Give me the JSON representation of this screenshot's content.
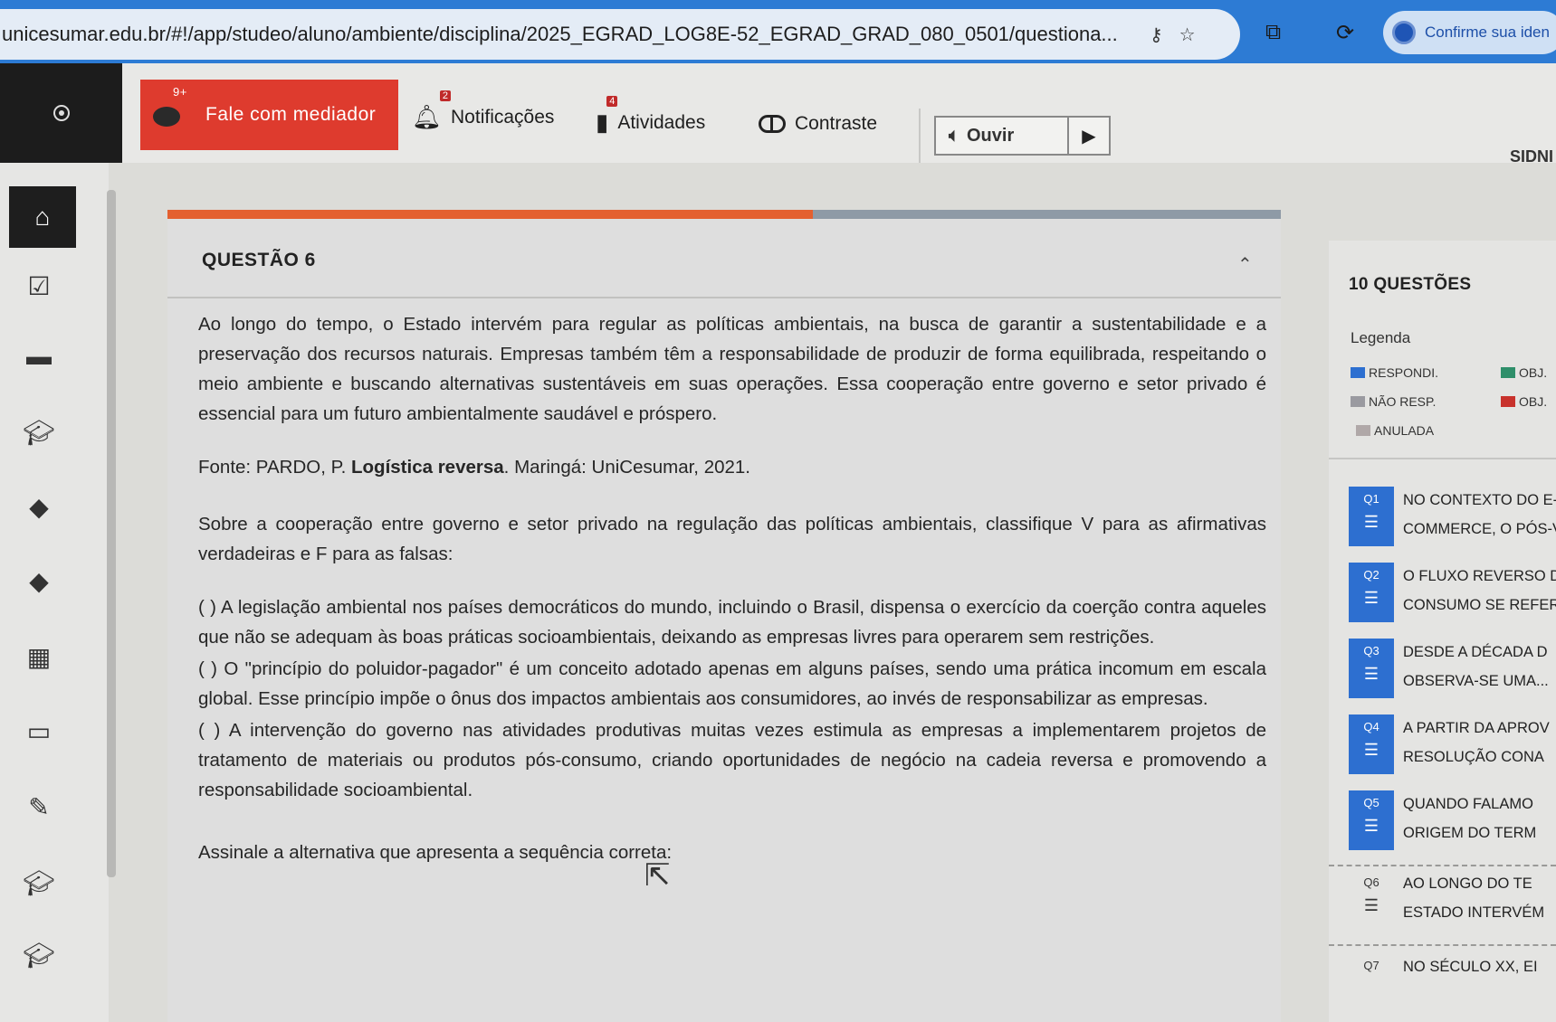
{
  "browser": {
    "url": "unicesumar.edu.br/#!/app/studeo/aluno/ambiente/disciplina/2025_EGRAD_LOG8E-52_EGRAD_GRAD_080_0501/questiona...",
    "identity_button": "Confirme sua iden"
  },
  "toolbar": {
    "mediator_label": "Fale com mediador",
    "mediator_badge": "9+",
    "notifications_label": "Notificações",
    "notifications_badge": "2",
    "activities_label": "Atividades",
    "activities_badge": "4",
    "contrast_label": "Contraste",
    "listen_label": "Ouvir",
    "user_name": "SIDNI"
  },
  "question": {
    "title": "QUESTÃO 6",
    "progress_percent": 58,
    "paragraph": "Ao longo do tempo, o Estado intervém para regular as políticas ambientais, na busca de garantir a sustentabilidade e a preservação dos recursos naturais. Empresas também têm a responsabilidade de produzir de forma equilibrada, respeitando o meio ambiente e buscando alternativas sustentáveis em suas operações. Essa cooperação entre governo e setor privado é essencial para um futuro ambientalmente saudável e próspero.",
    "source_prefix": "Fonte: PARDO, P. ",
    "source_title": "Logística reversa",
    "source_suffix": ". Maringá: UniCesumar, 2021.",
    "prompt": "Sobre a cooperação entre governo e setor privado na regulação das políticas ambientais, classifique V para as afirmativas verdadeiras e F para as falsas:",
    "statements": [
      "(   ) A legislação ambiental nos países democráticos do mundo, incluindo o Brasil, dispensa o exercício da coerção contra aqueles que não se adequam às boas práticas socioambientais, deixando as empresas livres para operarem sem restrições.",
      "(   ) O \"princípio do poluidor-pagador\" é um conceito adotado apenas em alguns países, sendo uma prática incomum em escala global. Esse princípio impõe o ônus dos impactos ambientais aos consumidores, ao invés de responsabilizar as empresas.",
      "(   ) A intervenção do governo nas atividades produtivas muitas vezes estimula as empresas a implementarem projetos de tratamento de materiais ou produtos pós-consumo, criando oportunidades de negócio na cadeia reversa e promovendo a responsabilidade socioambiental."
    ],
    "instruction": "Assinale a alternativa que apresenta a sequência correta:"
  },
  "panel": {
    "title": "10 QUESTÕES",
    "legend_title": "Legenda",
    "legend": [
      {
        "label": "RESPONDI.",
        "color": "#2d6fd0"
      },
      {
        "label": "OBJ.",
        "color": "#2f8f6a"
      },
      {
        "label": "NÃO RESP.",
        "color": "#9a9aa0"
      },
      {
        "label": "OBJ.",
        "color": "#c8322c"
      },
      {
        "label": "ANULADA",
        "color": "#b0a8a8"
      }
    ],
    "questions": [
      {
        "num": "Q1",
        "line1": "NO CONTEXTO DO E-",
        "line2": "COMMERCE, O PÓS-V"
      },
      {
        "num": "Q2",
        "line1": "O FLUXO REVERSO D",
        "line2": "CONSUMO SE REFER"
      },
      {
        "num": "Q3",
        "line1": "DESDE A DÉCADA D",
        "line2": "OBSERVA-SE UMA..."
      },
      {
        "num": "Q4",
        "line1": "A PARTIR DA APROV",
        "line2": "RESOLUÇÃO CONA"
      },
      {
        "num": "Q5",
        "line1": "QUANDO FALAMO",
        "line2": "ORIGEM DO TERM"
      },
      {
        "num": "Q6",
        "line1": "AO LONGO DO TE",
        "line2": "ESTADO INTERVÉM"
      },
      {
        "num": "Q7",
        "line1": "NO SÉCULO XX, EI",
        "line2": ""
      }
    ]
  }
}
